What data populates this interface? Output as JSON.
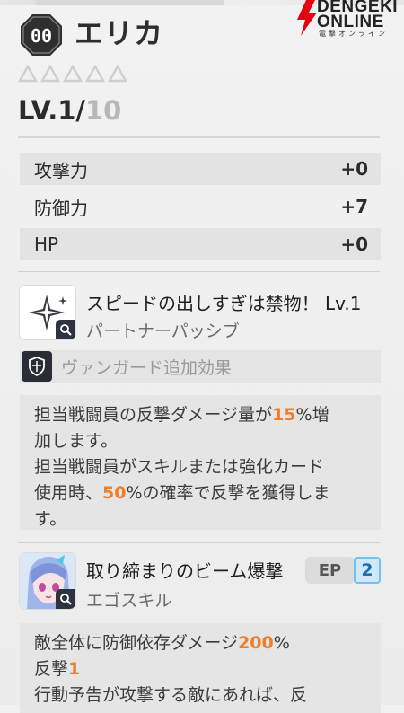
{
  "header": {
    "badge_label": "00",
    "name": "エリカ"
  },
  "logo": {
    "line1": "DENGEKI",
    "line2": "ONLINE",
    "line3": "電撃オンライン"
  },
  "rarity": {
    "stars_total": 5,
    "stars_filled": 0
  },
  "level": {
    "current": "LV.1/",
    "max": "10"
  },
  "stats": [
    {
      "label": "攻撃力",
      "value": "+0"
    },
    {
      "label": "防御力",
      "value": "+7"
    },
    {
      "label": "HP",
      "value": "+0"
    }
  ],
  "skill1": {
    "name": "スピードの出しすぎは禁物！ Lv.1",
    "type": "パートナーパッシブ",
    "vanguard_label": "ヴァンガード追加効果",
    "desc": {
      "l1a": "担当戦闘員の反撃ダメージ量が",
      "l1hi": "15",
      "l1b": "%増",
      "l2": "加します。",
      "l3": "担当戦闘員がスキルまたは強化カード",
      "l4a": "使用時、",
      "l4hi": "50",
      "l4b": "%の確率で反撃を獲得しま",
      "l5": "す。"
    }
  },
  "skill2": {
    "name": "取り締まりのビーム爆撃",
    "type": "エゴスキル",
    "ep_label": "EP",
    "ep_value": "2",
    "desc": {
      "l1a": "敵全体に防御依存ダメージ",
      "l1hi": "200",
      "l1b": "%",
      "l2a": "反撃",
      "l2hi": "1",
      "l3": "行動予告が攻撃する敵にあれば、反"
    }
  },
  "colors": {
    "highlight": "#ef7d29",
    "ep_accent": "#6fc3ee"
  }
}
